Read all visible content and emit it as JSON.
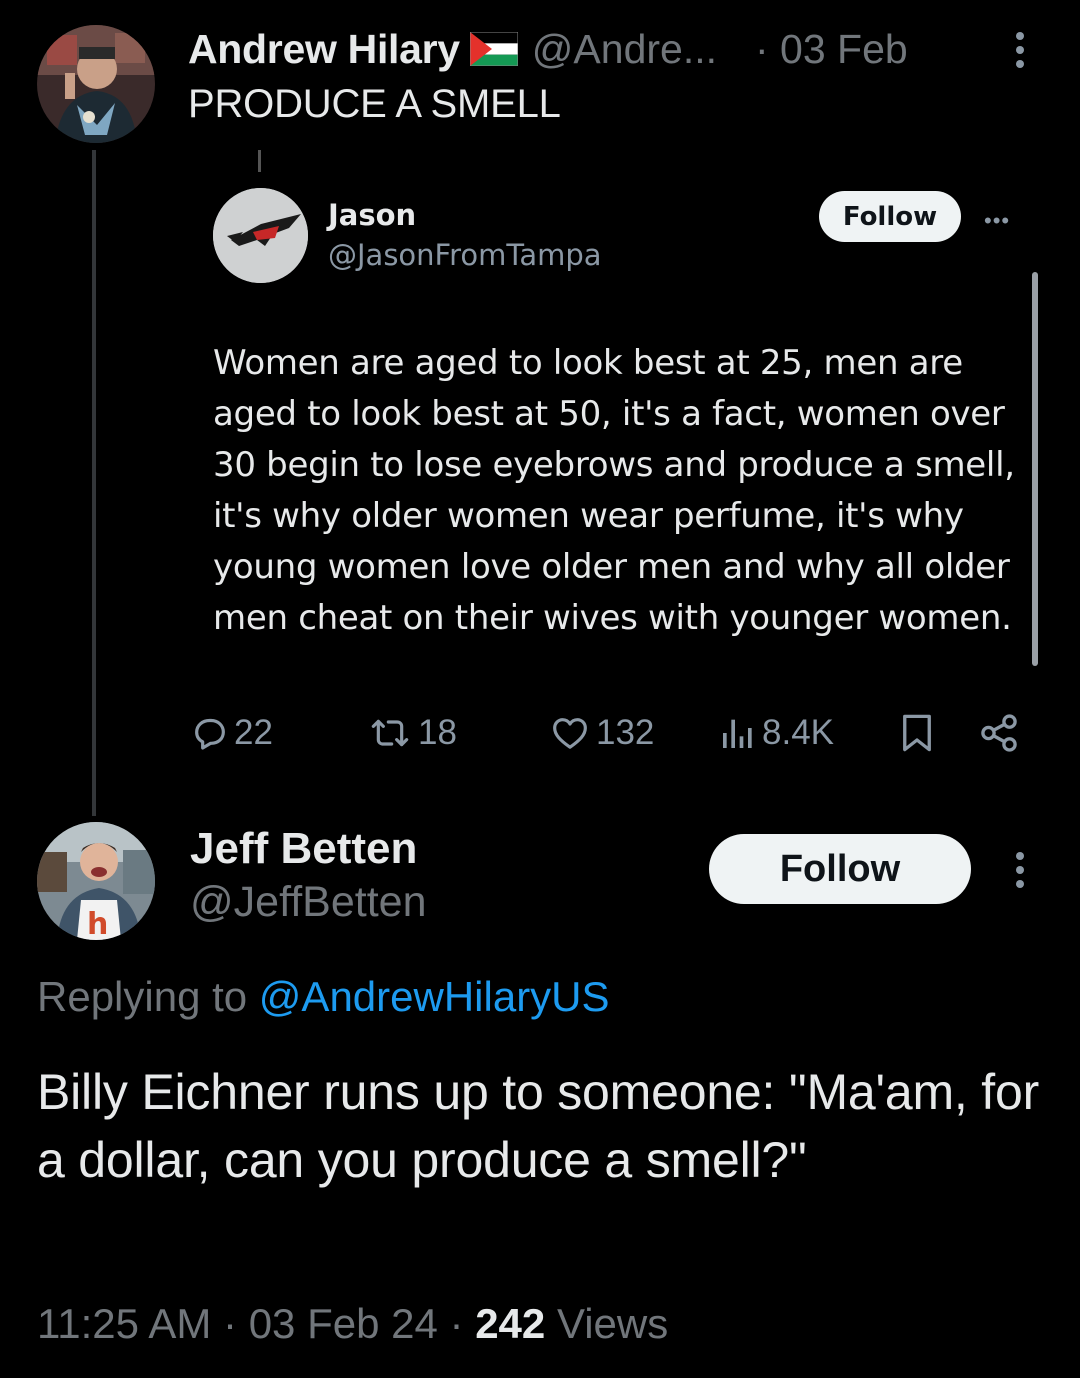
{
  "parent_tweet": {
    "author_name": "Andrew Hilary",
    "flag_icon": "palestine-flag-icon",
    "handle": "@Andre...",
    "date": "· 03 Feb",
    "text": "PRODUCE A SMELL"
  },
  "quoted_tweet": {
    "author_name": "Jason",
    "handle": "@JasonFromTampa",
    "follow_label": "Follow",
    "more_label": "•••",
    "text": "Women are aged to look best at 25, men are aged to look best at 50, it's a fact, women over 30 begin to lose eyebrows and produce a smell, it's why older women wear perfume, it's why young women love older men and why all older men cheat on their wives with younger women."
  },
  "actions": {
    "replies": "22",
    "retweets": "18",
    "likes": "132",
    "views": "8.4K"
  },
  "reply_tweet": {
    "author_name": "Jeff Betten",
    "handle": "@JeffBetten",
    "follow_label": "Follow",
    "replying_prefix": "Replying to ",
    "replying_mention": "@AndrewHilaryUS",
    "text": "Billy Eichner runs up to someone: \"Ma'am, for a dollar, can you produce a smell?\"",
    "time": "11:25 AM",
    "date": "03 Feb 24",
    "views_count": "242",
    "views_label": "Views",
    "separator": "·"
  },
  "colors": {
    "background": "#000000",
    "text_primary": "#e7e9ea",
    "text_secondary": "#71767b",
    "link": "#1d9bf0",
    "follow_bg": "#eff3f4"
  }
}
